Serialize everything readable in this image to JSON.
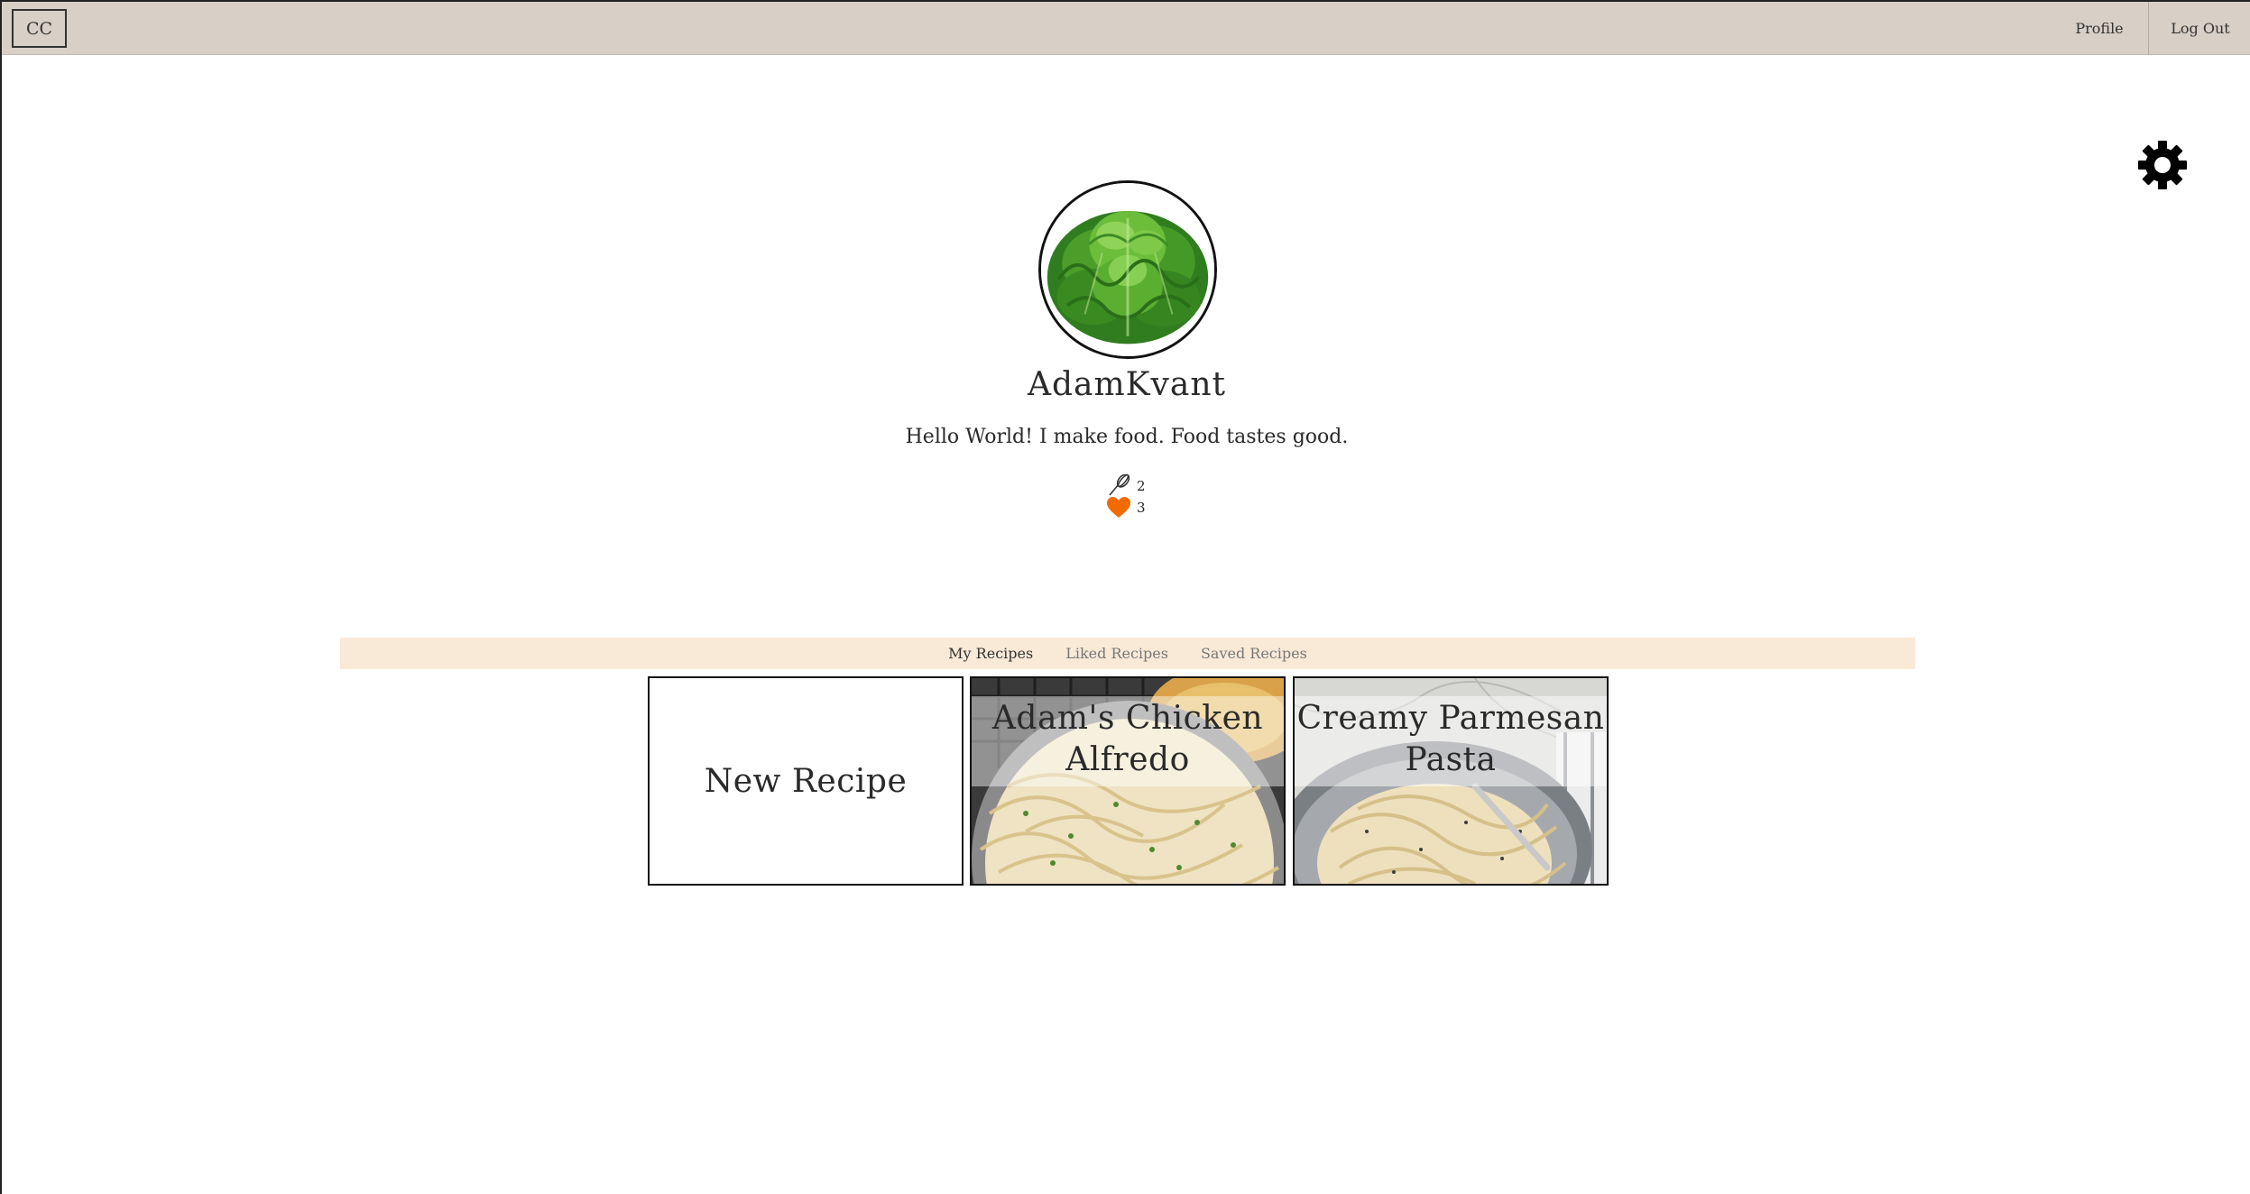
{
  "header": {
    "logo": "CC",
    "nav": {
      "profile": "Profile",
      "logout": "Log Out"
    }
  },
  "settings": {
    "icon": "gear-icon"
  },
  "profile": {
    "username": "AdamKvant",
    "bio": "Hello World! I make food. Food tastes good.",
    "stats": {
      "recipes_count": "2",
      "likes_count": "3",
      "recipes_icon": "whisk-icon",
      "likes_icon": "heart-icon",
      "like_color": "#f26b00"
    }
  },
  "tabs": [
    {
      "label": "My Recipes",
      "active": true
    },
    {
      "label": "Liked Recipes",
      "active": false
    },
    {
      "label": "Saved Recipes",
      "active": false
    }
  ],
  "cards": {
    "new_recipe": "New Recipe",
    "recipes": [
      {
        "title": "Adam's Chicken Alfredo"
      },
      {
        "title": "Creamy Parmesan Pasta"
      }
    ]
  },
  "colors": {
    "header_bg": "#d8cfc6",
    "tabbar_bg": "#f9ead7",
    "accent": "#f26b00"
  }
}
